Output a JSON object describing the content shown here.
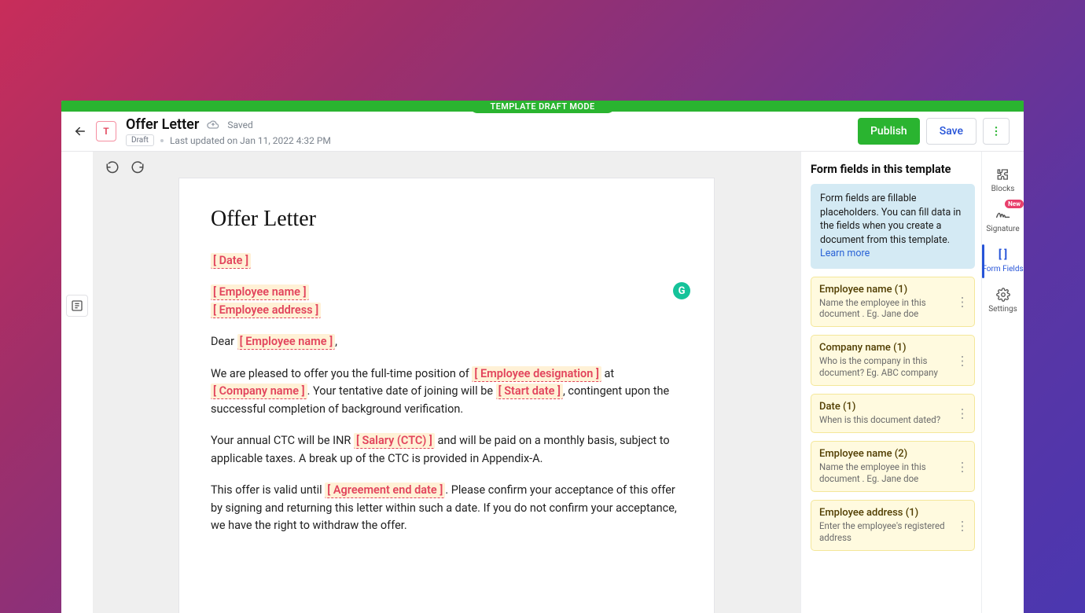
{
  "mode_banner": "TEMPLATE DRAFT MODE",
  "header": {
    "badge_letter": "T",
    "title": "Offer Letter",
    "saved_label": "Saved",
    "status_chip": "Draft",
    "last_updated": "Last updated on Jan 11, 2022 4:32 PM",
    "publish_label": "Publish",
    "save_label": "Save"
  },
  "doc": {
    "heading": "Offer Letter",
    "fields": {
      "date": "Date",
      "employee_name": "Employee name",
      "employee_address": "Employee address",
      "employee_designation": "Employee designation",
      "company_name": "Company name",
      "start_date": "Start date",
      "salary_ctc": "Salary (CTC)",
      "agreement_end_date": "Agreement end date"
    },
    "text": {
      "dear": "Dear ",
      "p1a": "We are pleased to offer you the full-time position of ",
      "p1b": " at ",
      "p1c": ". Your tentative date of joining will be ",
      "p1d": ", contingent upon the successful completion of background verification.",
      "p2a": "Your annual CTC will be INR ",
      "p2b": " and will be paid on a monthly basis, subject to applicable taxes. A break up of the CTC is provided in Appendix-A.",
      "p3a": "This offer is valid until ",
      "p3b": ". Please confirm your acceptance of this offer by signing and returning this letter within such a date. If you do not confirm your acceptance, we have the right to withdraw the offer."
    }
  },
  "form_panel": {
    "title": "Form fields in this template",
    "info_text": "Form fields are fillable placeholders. You can fill data in the fields when you create a document from this template. ",
    "info_link": "Learn more",
    "fields": [
      {
        "title": "Employee name (1)",
        "sub": "Name the employee in this document . Eg. Jane doe"
      },
      {
        "title": "Company name (1)",
        "sub": "Who is the company in this document? Eg. ABC company"
      },
      {
        "title": "Date (1)",
        "sub": "When is this document dated?"
      },
      {
        "title": "Employee name (2)",
        "sub": "Name the employee in this document . Eg. Jane doe"
      },
      {
        "title": "Employee address (1)",
        "sub": "Enter the employee's registered address"
      }
    ]
  },
  "right_rail": {
    "blocks": "Blocks",
    "signature": "Signature",
    "signature_badge": "New",
    "form_fields": "Form Fields",
    "settings": "Settings"
  },
  "grammarly_letter": "G"
}
